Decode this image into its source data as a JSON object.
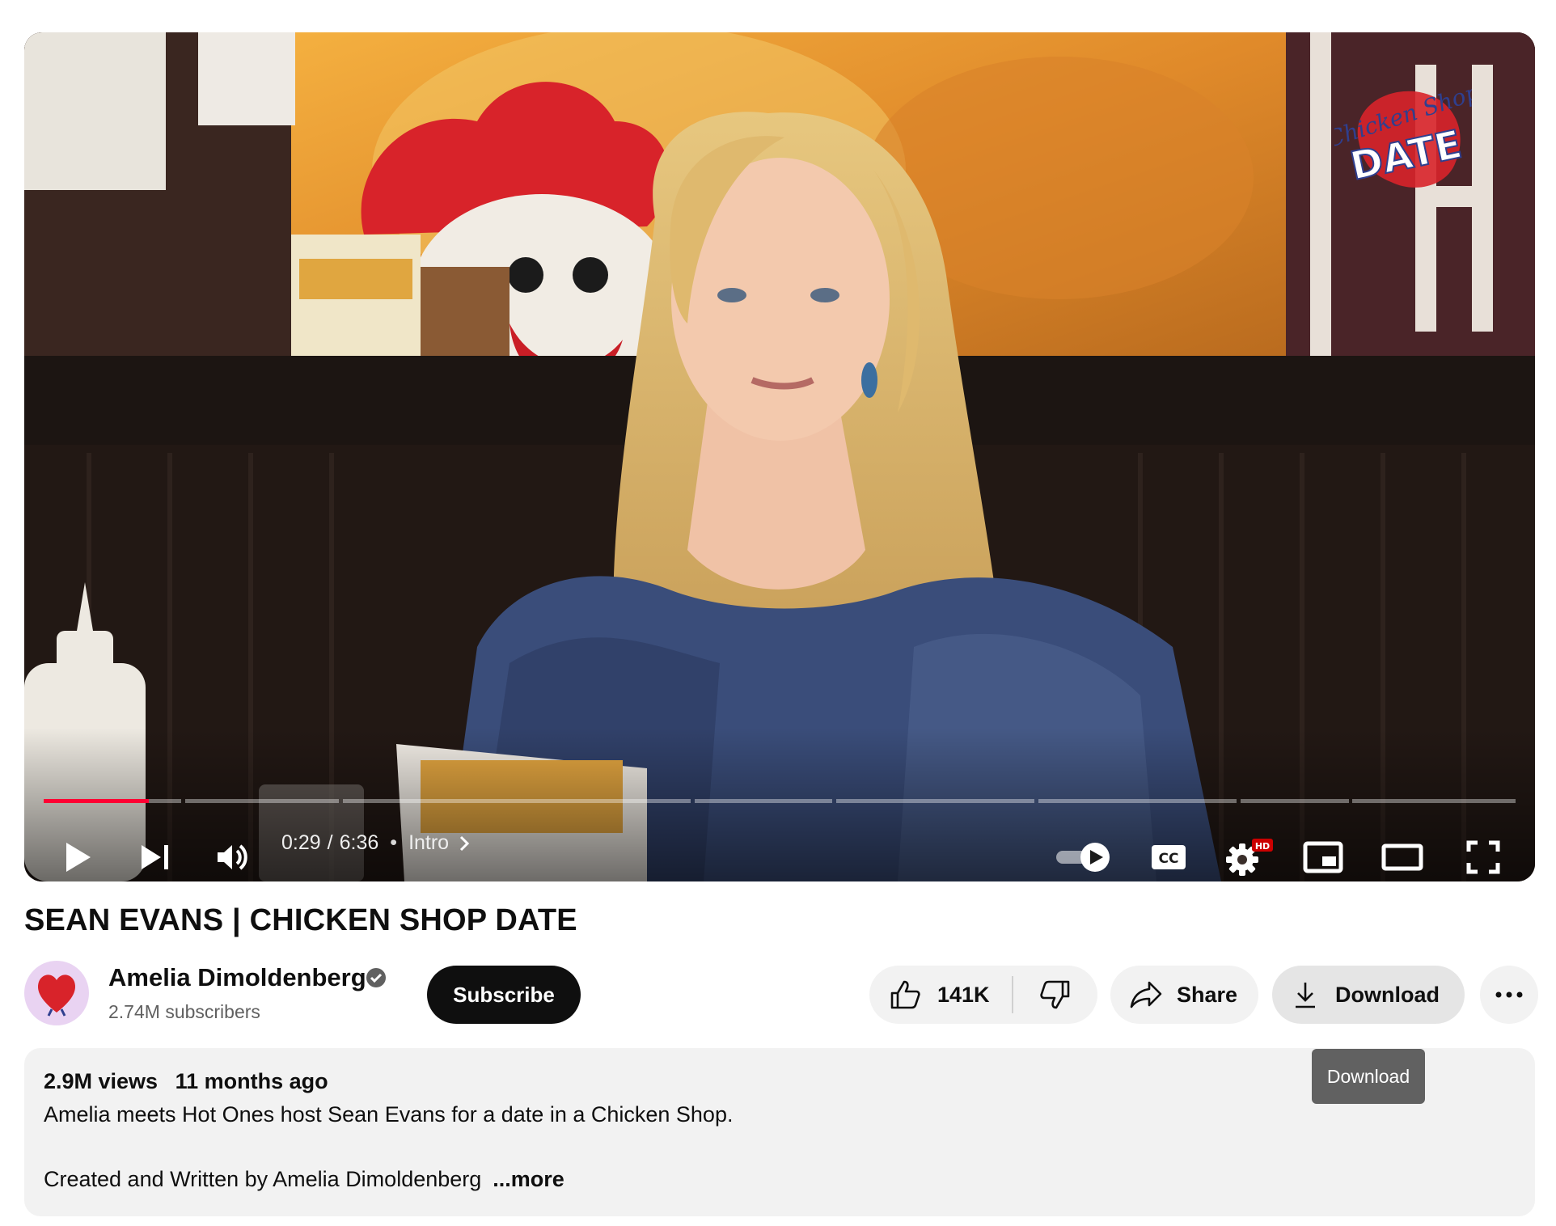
{
  "player": {
    "time_current": "0:29",
    "time_separator": "/",
    "time_total": "6:36",
    "chapter_dot": "•",
    "chapter": "Intro",
    "progress_fraction": 0.0736,
    "hd_badge": "HD",
    "cc_label": "CC",
    "overlay_logo_line1": "Chicken Shop",
    "overlay_logo_line2": "DATE",
    "icons": [
      "play-icon",
      "next-icon",
      "volume-icon",
      "chevron-right-icon",
      "autoplay-toggle-icon",
      "captions-icon",
      "settings-icon",
      "miniplayer-icon",
      "theater-icon",
      "fullscreen-icon"
    ],
    "colors": {
      "progress_played": "#ff0033"
    }
  },
  "video": {
    "title": "SEAN EVANS | CHICKEN SHOP DATE"
  },
  "channel": {
    "name": "Amelia Dimoldenberg",
    "subscribers": "2.74M subscribers",
    "subscribe_label": "Subscribe"
  },
  "actions": {
    "likes": "141K",
    "share_label": "Share",
    "download_label": "Download",
    "tooltip": "Download"
  },
  "description": {
    "views": "2.9M views",
    "age": "11 months ago",
    "line1": "Amelia meets Hot Ones host Sean Evans for a date in a Chicken Shop.",
    "line2": "Created and Written by Amelia Dimoldenberg",
    "more_label": "...more"
  }
}
